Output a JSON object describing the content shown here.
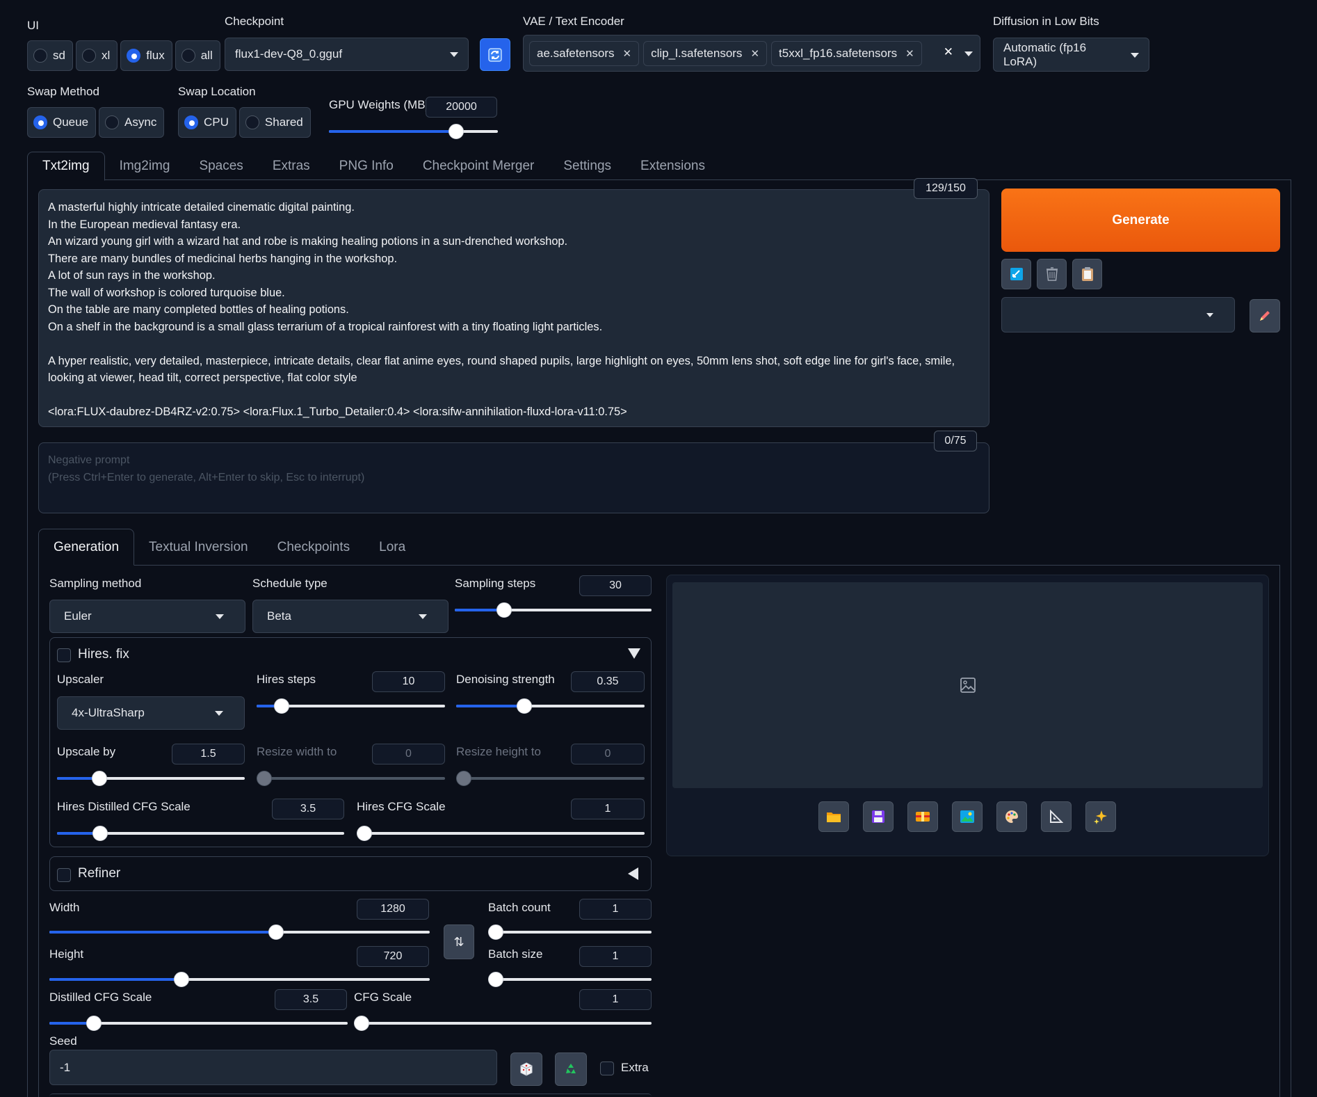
{
  "top": {
    "ui_label": "UI",
    "ui_options": [
      "sd",
      "xl",
      "flux",
      "all"
    ],
    "ui_selected": "flux",
    "checkpoint_label": "Checkpoint",
    "checkpoint_value": "flux1-dev-Q8_0.gguf",
    "vae_label": "VAE / Text Encoder",
    "vae_chips": [
      "ae.safetensors",
      "clip_l.safetensors",
      "t5xxl_fp16.safetensors"
    ],
    "lowbits_label": "Diffusion in Low Bits",
    "lowbits_value": "Automatic (fp16 LoRA)",
    "swap_method_label": "Swap Method",
    "swap_method_options": [
      "Queue",
      "Async"
    ],
    "swap_method_selected": "Queue",
    "swap_location_label": "Swap Location",
    "swap_location_options": [
      "CPU",
      "Shared"
    ],
    "swap_location_selected": "CPU",
    "gpu_weights_label": "GPU Weights (MB)",
    "gpu_weights_value": "20000",
    "gpu_weights_fraction": 0.78
  },
  "main_tabs": [
    "Txt2img",
    "Img2img",
    "Spaces",
    "Extras",
    "PNG Info",
    "Checkpoint Merger",
    "Settings",
    "Extensions"
  ],
  "main_tab_active": "Txt2img",
  "prompt": {
    "counter": "129/150",
    "text": "A masterful highly intricate detailed cinematic digital painting.\nIn the European medieval fantasy era.\nAn wizard young girl with a wizard hat and robe is making healing potions in a sun-drenched workshop.\nThere are many bundles of medicinal herbs hanging in the workshop.\nA lot of sun rays in the workshop.\nThe wall of workshop is colored turquoise blue.\nOn the table are many completed bottles of healing potions.\nOn a shelf in the background is a small glass terrarium of a tropical rainforest with a tiny floating light particles.\n\nA hyper realistic, very detailed, masterpiece, intricate details, clear flat anime eyes, round shaped pupils, large highlight on eyes, 50mm lens shot, soft edge line for girl's face, smile,\nlooking at viewer, head tilt, correct perspective, flat color style\n\n<lora:FLUX-daubrez-DB4RZ-v2:0.75> <lora:Flux.1_Turbo_Detailer:0.4> <lora:sifw-annihilation-fluxd-lora-v11:0.75>"
  },
  "negative": {
    "counter": "0/75",
    "placeholder": "Negative prompt\n(Press Ctrl+Enter to generate, Alt+Enter to skip, Esc to interrupt)"
  },
  "generate_label": "Generate",
  "action_icons": [
    "apply-styles-icon",
    "trash-icon",
    "clipboard-icon"
  ],
  "styles_value": "",
  "sub_tabs": [
    "Generation",
    "Textual Inversion",
    "Checkpoints",
    "Lora"
  ],
  "sub_tab_active": "Generation",
  "gen": {
    "sampling_method_label": "Sampling method",
    "sampling_method_value": "Euler",
    "schedule_type_label": "Schedule type",
    "schedule_type_value": "Beta",
    "sampling_steps_label": "Sampling steps",
    "sampling_steps_value": "30",
    "sampling_steps_fraction": 0.23,
    "hires_label": "Hires. fix",
    "upscaler_label": "Upscaler",
    "upscaler_value": "4x-UltraSharp",
    "hires_steps_label": "Hires steps",
    "hires_steps_value": "10",
    "hires_steps_fraction": 0.1,
    "denoise_label": "Denoising strength",
    "denoise_value": "0.35",
    "denoise_fraction": 0.35,
    "upscale_by_label": "Upscale by",
    "upscale_by_value": "1.5",
    "upscale_by_fraction": 0.2,
    "resize_w_label": "Resize width to",
    "resize_w_value": "0",
    "resize_h_label": "Resize height to",
    "resize_h_value": "0",
    "hires_dcfg_label": "Hires Distilled CFG Scale",
    "hires_dcfg_value": "3.5",
    "hires_dcfg_fraction": 0.13,
    "hires_cfg_label": "Hires CFG Scale",
    "hires_cfg_value": "1",
    "hires_cfg_fraction": 0.0,
    "refiner_label": "Refiner",
    "width_label": "Width",
    "width_value": "1280",
    "width_fraction": 0.6,
    "height_label": "Height",
    "height_value": "720",
    "height_fraction": 0.34,
    "batch_count_label": "Batch count",
    "batch_count_value": "1",
    "batch_size_label": "Batch size",
    "batch_size_value": "1",
    "dcfg_label": "Distilled CFG Scale",
    "dcfg_value": "3.5",
    "dcfg_fraction": 0.13,
    "cfg_label": "CFG Scale",
    "cfg_value": "1",
    "cfg_fraction": 0.0,
    "seed_label": "Seed",
    "seed_value": "-1",
    "extra_label": "Extra"
  },
  "output_icons": [
    "folder-icon",
    "save-icon",
    "zip-icon",
    "send-to-img2img-icon",
    "send-to-inpaint-icon",
    "send-to-extras-icon",
    "upscale-icon"
  ]
}
